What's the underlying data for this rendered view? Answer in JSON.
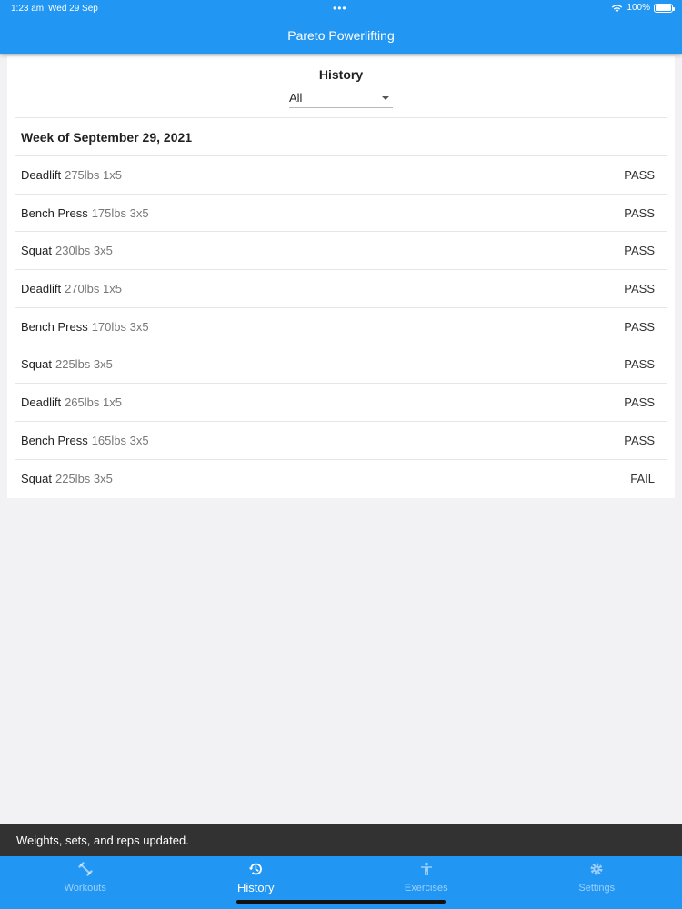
{
  "status_bar": {
    "time": "1:23 am",
    "date": "Wed 29 Sep",
    "battery": "100%"
  },
  "app": {
    "title": "Pareto Powerlifting"
  },
  "history": {
    "title": "History",
    "filter": {
      "selected": "All"
    },
    "week_header": "Week of September 29, 2021",
    "entries": [
      {
        "exercise": "Deadlift",
        "detail": "275lbs 1x5",
        "result": "PASS"
      },
      {
        "exercise": "Bench Press",
        "detail": "175lbs 3x5",
        "result": "PASS"
      },
      {
        "exercise": "Squat",
        "detail": "230lbs 3x5",
        "result": "PASS"
      },
      {
        "exercise": "Deadlift",
        "detail": "270lbs 1x5",
        "result": "PASS"
      },
      {
        "exercise": "Bench Press",
        "detail": "170lbs 3x5",
        "result": "PASS"
      },
      {
        "exercise": "Squat",
        "detail": "225lbs 3x5",
        "result": "PASS"
      },
      {
        "exercise": "Deadlift",
        "detail": "265lbs 1x5",
        "result": "PASS"
      },
      {
        "exercise": "Bench Press",
        "detail": "165lbs 3x5",
        "result": "PASS"
      },
      {
        "exercise": "Squat",
        "detail": "225lbs 3x5",
        "result": "FAIL"
      }
    ]
  },
  "snackbar": {
    "message": "Weights, sets, and reps updated."
  },
  "bottom_nav": {
    "items": [
      {
        "label": "Workouts",
        "icon": "workout-icon"
      },
      {
        "label": "History",
        "icon": "history-icon"
      },
      {
        "label": "Exercises",
        "icon": "person-icon"
      },
      {
        "label": "Settings",
        "icon": "gear-icon"
      }
    ],
    "active_index": 1
  },
  "colors": {
    "primary": "#2196f3",
    "snackbar": "#323232",
    "background": "#f2f2f4"
  }
}
